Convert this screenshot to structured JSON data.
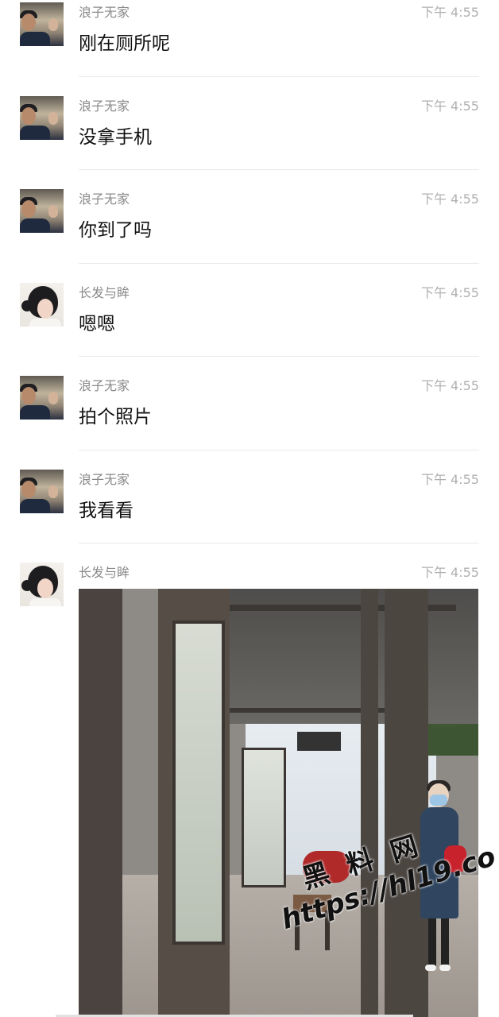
{
  "messages": [
    {
      "sender": "浪子无家",
      "time": "下午 4:55",
      "text": "刚在厕所呢",
      "avatar": "male"
    },
    {
      "sender": "浪子无家",
      "time": "下午 4:55",
      "text": "没拿手机",
      "avatar": "male"
    },
    {
      "sender": "浪子无家",
      "time": "下午 4:55",
      "text": "你到了吗",
      "avatar": "male"
    },
    {
      "sender": "长发与眸",
      "time": "下午 4:55",
      "text": "嗯嗯",
      "avatar": "female"
    },
    {
      "sender": "浪子无家",
      "time": "下午 4:55",
      "text": "拍个照片",
      "avatar": "male"
    },
    {
      "sender": "浪子无家",
      "time": "下午 4:55",
      "text": "我看看",
      "avatar": "male"
    },
    {
      "sender": "长发与眸",
      "time": "下午 4:55",
      "text": "",
      "avatar": "female",
      "image": "bus-stop-photo"
    }
  ],
  "watermark": {
    "cn": "黑 料 网",
    "url": "https://hl19.co"
  }
}
